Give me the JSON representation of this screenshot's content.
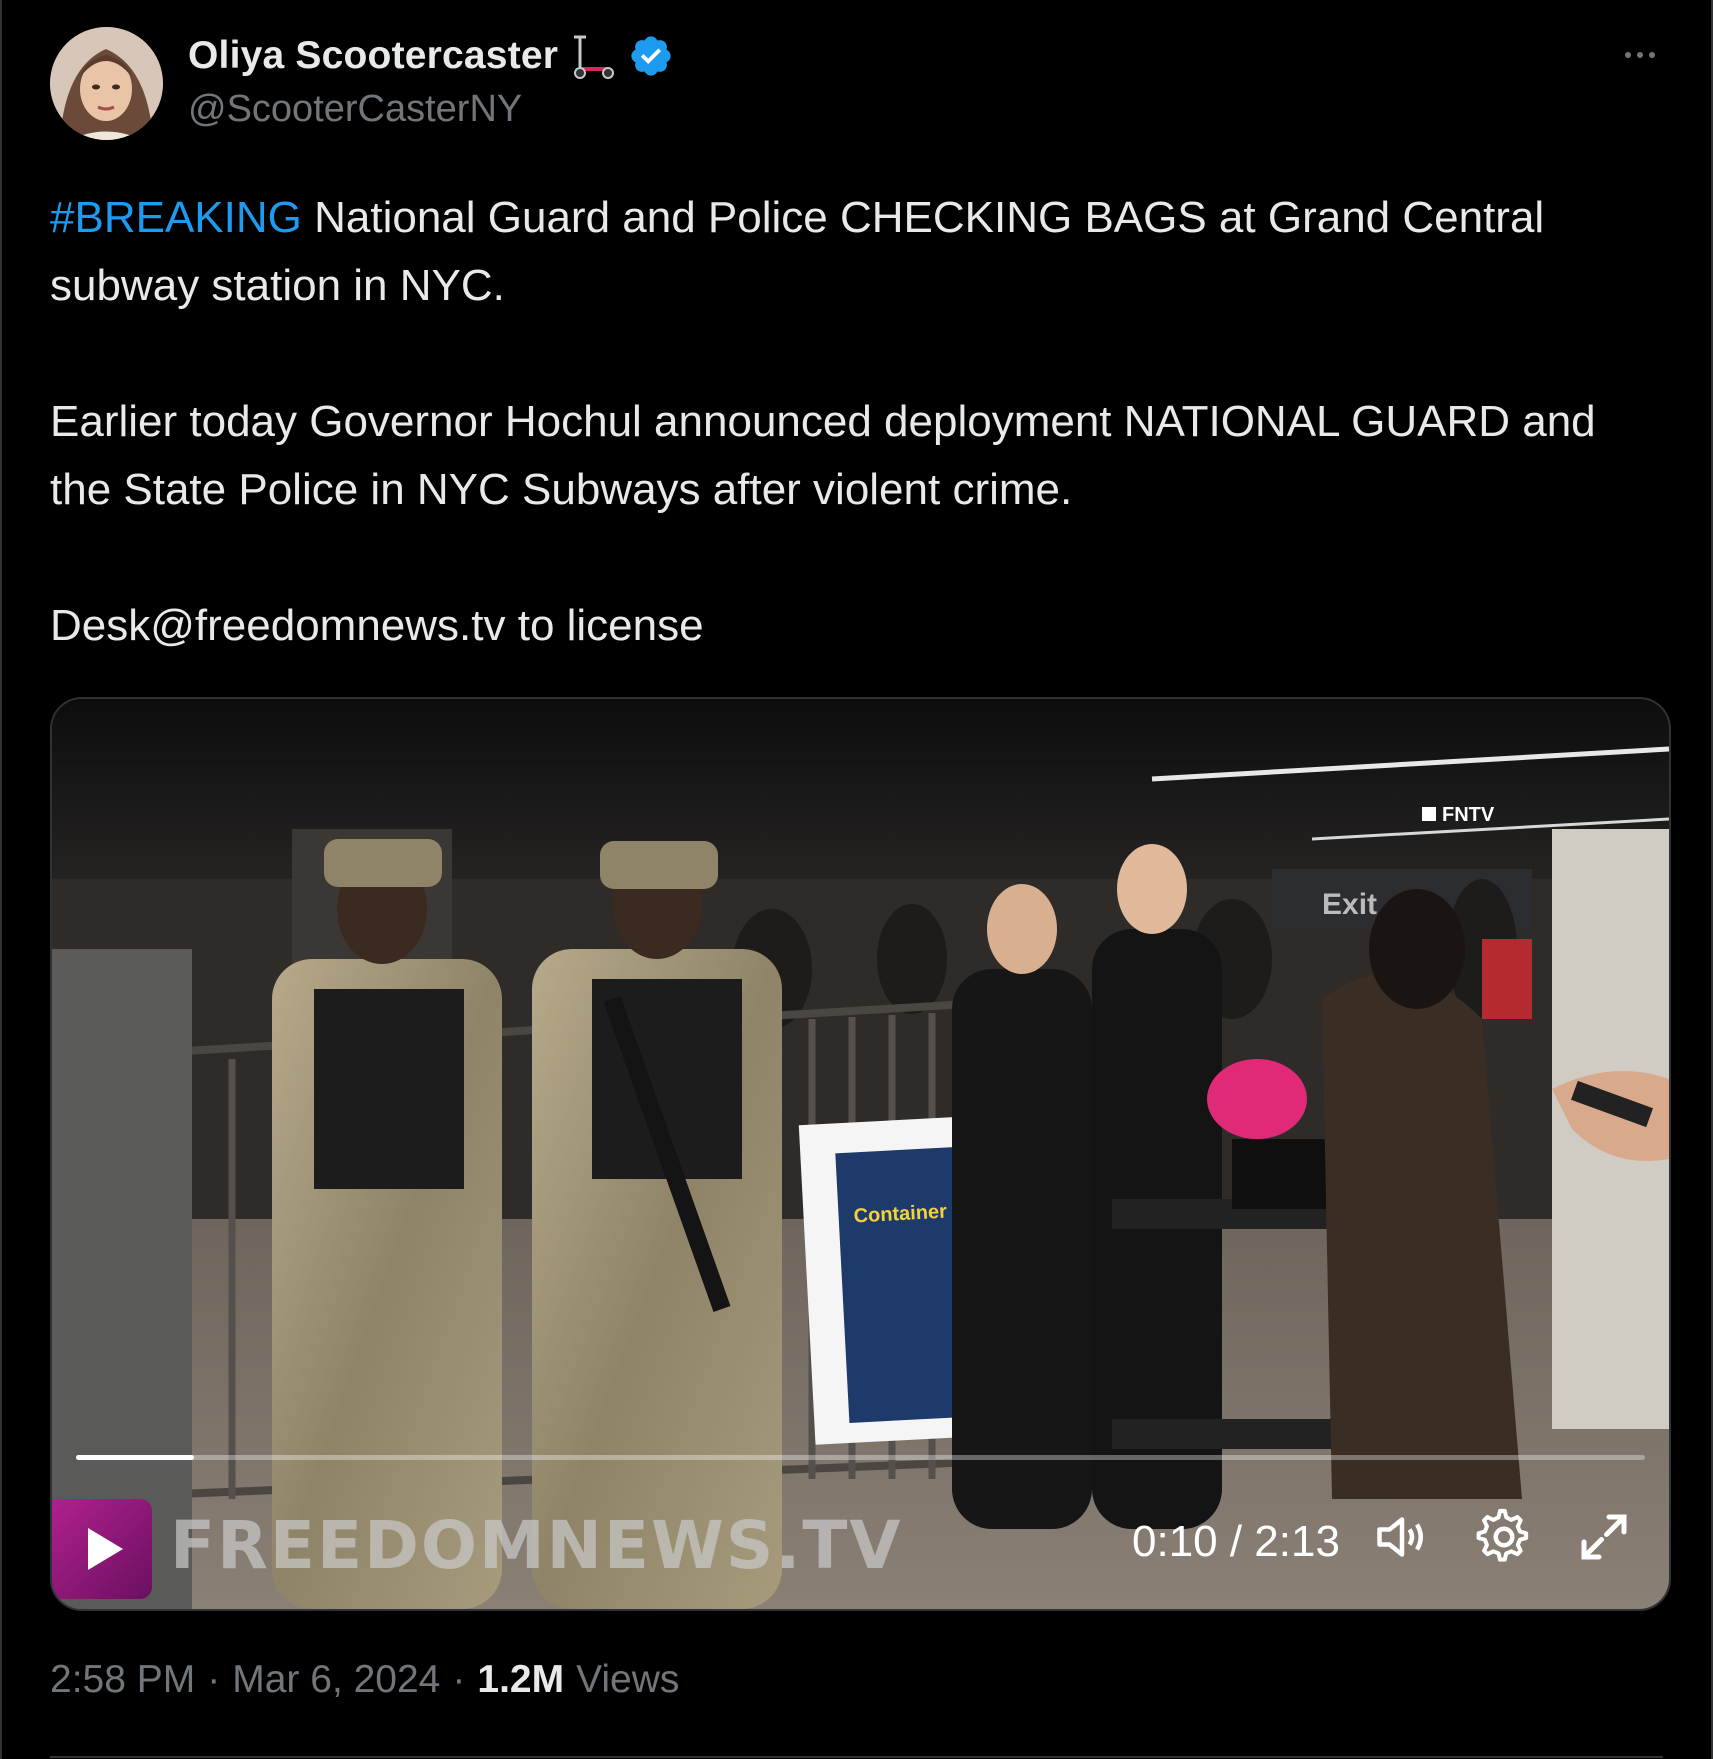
{
  "author": {
    "display_name": "Oliya Scootercaster",
    "handle": "@ScooterCasterNY",
    "verified": true,
    "emoji_icon": "kick-scooter-icon"
  },
  "tweet": {
    "hashtag": "#BREAKING",
    "line1_rest": " National Guard and Police CHECKING BAGS at Grand Central subway station in NYC.",
    "paragraph2": "Earlier today Governor Hochul announced deployment NATIONAL GUARD and the State Police in NYC Subways after violent crime.",
    "paragraph3": "Desk@freedomnews.tv to license"
  },
  "video": {
    "watermark": "FREEDOMNEWS.TV",
    "time": "0:10 / 2:13",
    "progress": 0.075,
    "sign_text": "Container Inspection",
    "corner_tag": "FNTV",
    "exit_sign": "Exit"
  },
  "footer": {
    "time": "2:58 PM",
    "date": "Mar 6, 2024",
    "views_count": "1.2M",
    "views_label": "Views"
  },
  "colors": {
    "background": "#000000",
    "text": "#e7e9ea",
    "muted": "#71767b",
    "link": "#1d9bf0",
    "verified": "#1d9bf0",
    "border": "#2f3336"
  }
}
